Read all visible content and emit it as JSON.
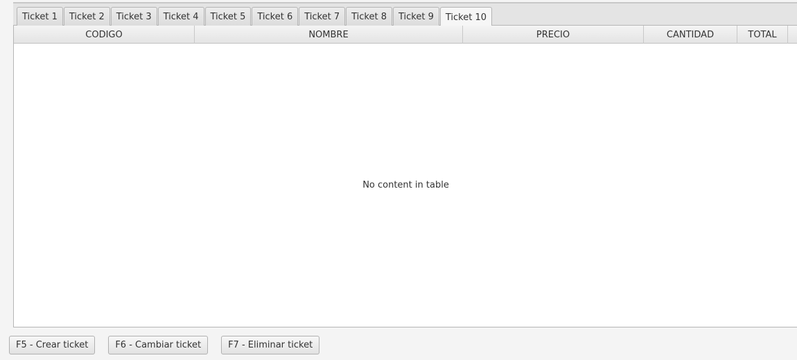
{
  "tabs": [
    {
      "label": "Ticket 1"
    },
    {
      "label": "Ticket 2"
    },
    {
      "label": "Ticket 3"
    },
    {
      "label": "Ticket 4"
    },
    {
      "label": "Ticket 5"
    },
    {
      "label": "Ticket 6"
    },
    {
      "label": "Ticket 7"
    },
    {
      "label": "Ticket 8"
    },
    {
      "label": "Ticket 9"
    },
    {
      "label": "Ticket 10"
    }
  ],
  "active_tab": "Ticket 10",
  "table": {
    "columns": [
      "CODIGO",
      "NOMBRE",
      "PRECIO",
      "CANTIDAD",
      "TOTAL"
    ],
    "rows": [],
    "placeholder": "No content in table"
  },
  "actions": {
    "create": "F5 - Crear ticket",
    "change": "F6 - Cambiar ticket",
    "delete": "F7 - Eliminar ticket"
  }
}
